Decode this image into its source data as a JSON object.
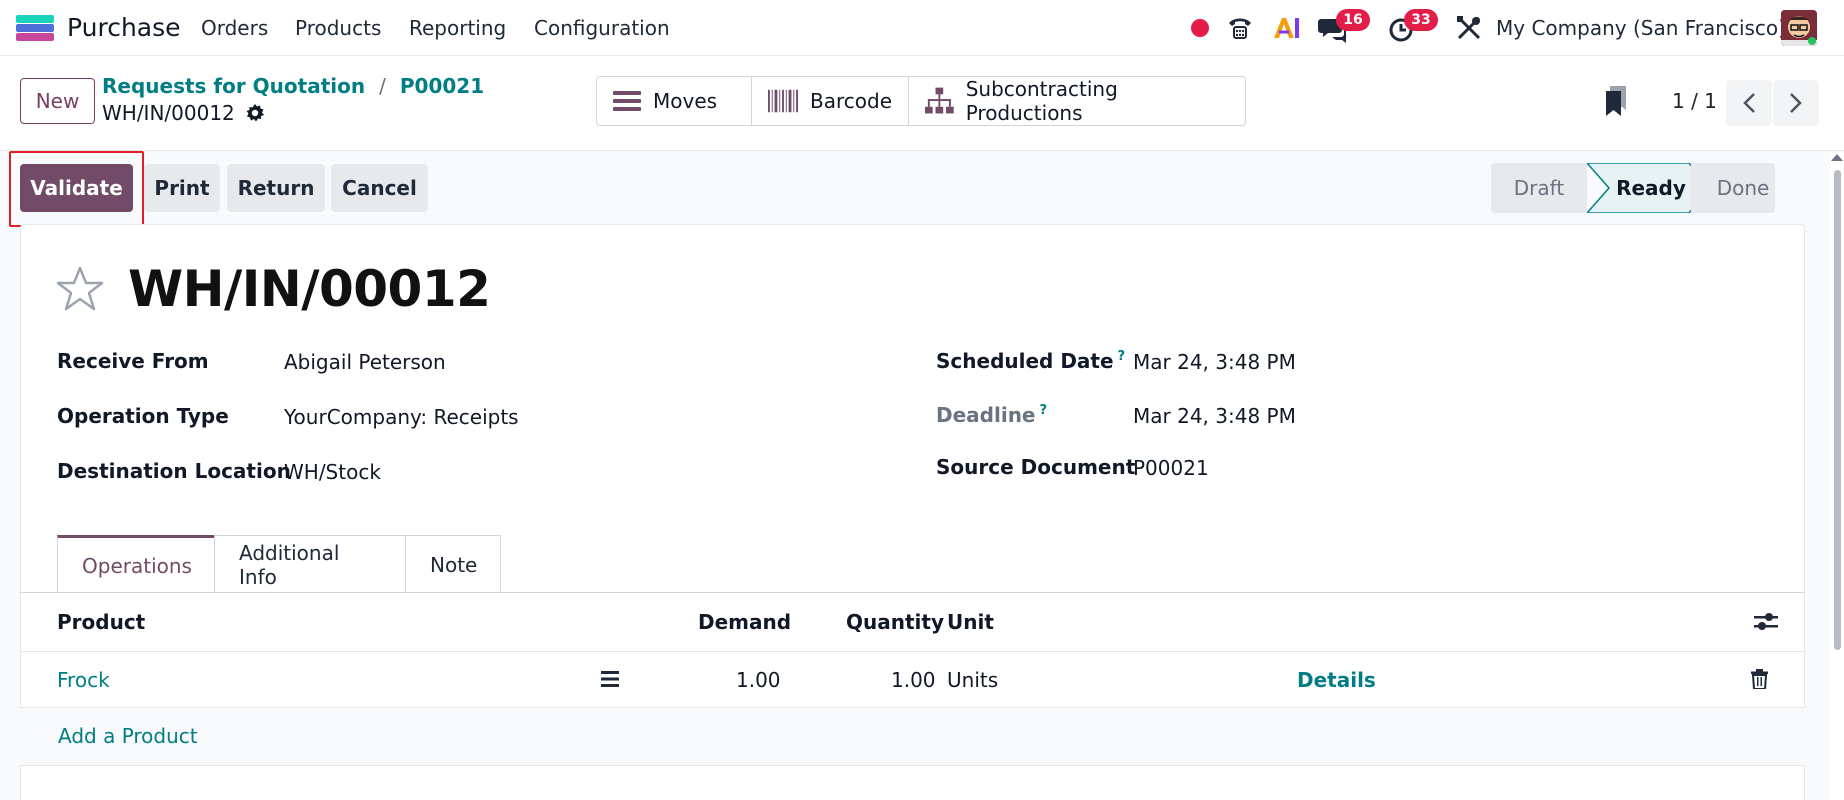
{
  "app": {
    "name": "Purchase",
    "menu": [
      "Orders",
      "Products",
      "Reporting",
      "Configuration"
    ],
    "company": "My Company (San Francisco)",
    "badges": {
      "messages": "16",
      "activities": "33"
    }
  },
  "control": {
    "new_label": "New",
    "breadcrumb": [
      "Requests for Quotation",
      "P00021"
    ],
    "breadcrumb_sep": "/",
    "record": "WH/IN/00012",
    "smart_buttons": [
      "Moves",
      "Barcode",
      "Subcontracting Productions"
    ],
    "pager": "1 / 1"
  },
  "actions": {
    "validate": "Validate",
    "print": "Print",
    "return": "Return",
    "cancel": "Cancel"
  },
  "stages": [
    "Draft",
    "Ready",
    "Done"
  ],
  "active_stage": "Ready",
  "form": {
    "title": "WH/IN/00012",
    "help_mark": "?",
    "left": [
      {
        "label": "Receive From",
        "value": "Abigail Peterson"
      },
      {
        "label": "Operation Type",
        "value": "YourCompany: Receipts"
      },
      {
        "label": "Destination Location",
        "value": "WH/Stock"
      }
    ],
    "right": [
      {
        "label": "Scheduled Date",
        "value": "Mar 24, 3:48 PM"
      },
      {
        "label": "Deadline",
        "value": "Mar 24, 3:48 PM"
      },
      {
        "label": "Source Document",
        "value": "P00021"
      }
    ]
  },
  "tabs": [
    "Operations",
    "Additional Info",
    "Note"
  ],
  "table": {
    "headers": {
      "product": "Product",
      "demand": "Demand",
      "quantity": "Quantity",
      "unit": "Unit"
    },
    "rows": [
      {
        "product": "Frock",
        "demand": "1.00",
        "quantity": "1.00",
        "unit": "Units",
        "details": "Details"
      }
    ],
    "add_label": "Add a Product"
  },
  "colors": {
    "brand": "#714b67",
    "link": "#017e84",
    "badge": "#e11d48"
  }
}
